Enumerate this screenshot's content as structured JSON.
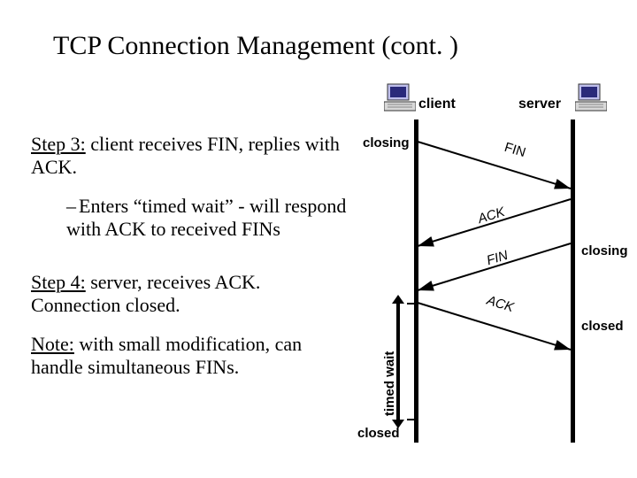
{
  "title": "TCP Connection Management (cont. )",
  "step3": {
    "lead": "Step 3:",
    "tail": " client receives FIN, replies with ACK."
  },
  "sub": {
    "text": "Enters “timed wait” - will respond with ACK to received FINs"
  },
  "step4": {
    "lead": "Step 4:",
    "tail": " server, receives ACK.  Connection closed."
  },
  "note": {
    "lead": "Note:",
    "tail": " with small modification, can handle simultaneous FINs."
  },
  "diagram": {
    "client_label": "client",
    "server_label": "server",
    "closing": "closing",
    "closed": "closed",
    "timed_wait": "timed wait",
    "fin": "FIN",
    "ack": "ACK"
  }
}
